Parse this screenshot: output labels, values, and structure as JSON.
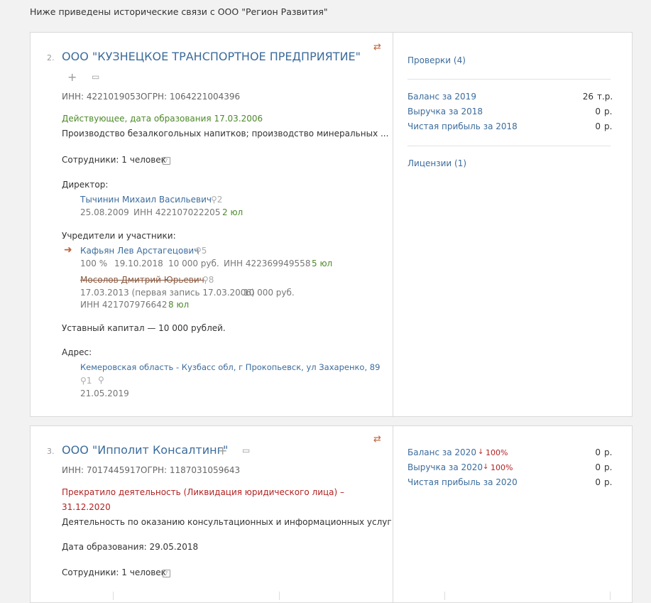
{
  "intro": "Ниже приведены исторические связи с ООО \"Регион Развития\"",
  "card1": {
    "number": "2.",
    "title": "ООО \"КУЗНЕЦКОЕ ТРАНСПОРТНОЕ ПРЕДПРИЯТИЕ\"",
    "inn": "ИНН: 4221019053",
    "ogrn": "ОГРН: 1064221004396",
    "status": "Действующее, дата образования 17.03.2006",
    "activity": "Производство безалкогольных напитков; производство минеральных ...",
    "employees": "Сотрудники: 1 человек",
    "director_label": "Директор:",
    "director": {
      "name": "Тычинин Михаил Васильевич",
      "count": "2",
      "date": "25.08.2009",
      "inn": "ИНН 422107022205",
      "ul": "2 юл"
    },
    "founders_label": "Учредители и участники:",
    "founders": [
      {
        "name": "Кафьян Лев Арстагецович",
        "count": "5",
        "share": "100 %",
        "date": "19.10.2018",
        "amount": "10 000 руб.",
        "inn": "ИНН 422369949558",
        "ul": "5 юл"
      },
      {
        "name": "Мосолов Дмитрий Юрьевич",
        "count": "8",
        "date": "17.03.2013 (первая запись 17.03.2006)",
        "amount": "10 000 руб.",
        "inn": "ИНН 421707976642",
        "ul": "8 юл"
      }
    ],
    "capital": "Уставный капитал — 10 000 рублей.",
    "address_label": "Адрес:",
    "address": "Кемеровская область - Кузбасс обл, г Прокопьевск, ул Захаренко, 89",
    "address_count": "1",
    "address_date": "21.05.2019",
    "right": {
      "checks": "Проверки (4)",
      "finance": [
        {
          "label": "Баланс за 2019",
          "value": "26",
          "unit": "т.р."
        },
        {
          "label": "Выручка за 2018",
          "value": "0",
          "unit": "р."
        },
        {
          "label": "Чистая прибыль за 2018",
          "value": "0",
          "unit": "р."
        }
      ],
      "licenses": "Лицензии (1)"
    }
  },
  "card2": {
    "number": "3.",
    "title": "ООО \"Ипполит Консалтинг\"",
    "inn": "ИНН: 7017445917",
    "ogrn": "ОГРН: 1187031059643",
    "status_line1": "Прекратило деятельность (Ликвидация юридического лица) –",
    "status_line2": "31.12.2020",
    "activity": "Деятельность по оказанию консультационных и информационных услуг",
    "founded": "Дата образования: 29.05.2018",
    "employees": "Сотрудники: 1 человек",
    "right": {
      "finance": [
        {
          "label": "Баланс за 2020",
          "change": "100%",
          "value": "0",
          "unit": "р."
        },
        {
          "label": "Выручка за 2020",
          "change": "100%",
          "value": "0",
          "unit": "р."
        },
        {
          "label": "Чистая прибыль за 2020",
          "value": "0",
          "unit": "р."
        }
      ]
    }
  },
  "icons": {
    "plus": "+",
    "comment": "▭",
    "swap": "⇄",
    "search": "⚲",
    "help": "?",
    "pin": "⚲",
    "arrow": "➜",
    "down": "↓"
  },
  "colors": {
    "link": "#3c6c9c",
    "active_status": "#4c8a2a",
    "closed_status": "#b22222",
    "arrow": "#c0603a"
  }
}
